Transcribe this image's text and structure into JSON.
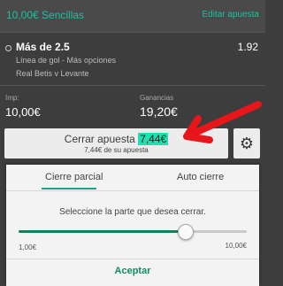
{
  "header": {
    "title": "10,00€ Sencillas",
    "edit_label": "Editar apuesta"
  },
  "selection": {
    "name": "Más de 2.5",
    "market": "Línea de gol - Más opciones",
    "event": "Real Betis v Levante",
    "odds": "1.92"
  },
  "stake": {
    "label": "Imp:",
    "value": "10,00€"
  },
  "returns": {
    "label": "Ganancias",
    "value": "19,20€"
  },
  "cashout": {
    "label": "Cerrar apuesta",
    "amount": "7,44€",
    "sub": "7,44€ de su apuesta"
  },
  "icons": {
    "settings": "gear-icon",
    "annotation": "red-arrow-icon",
    "radio": "radio-icon"
  },
  "colors": {
    "accent": "#14c59f",
    "highlight": "#1ee0b0",
    "arrow": "#e8151b",
    "slider": "#10815f"
  },
  "panel": {
    "tabs": [
      {
        "label": "Cierre parcial",
        "active": true
      },
      {
        "label": "Auto cierre",
        "active": false
      }
    ],
    "prompt": "Seleccione la parte que desea cerrar.",
    "slider": {
      "min_label": "1,00€",
      "max_label": "10,00€",
      "value_fraction": 0.73
    },
    "accept_label": "Aceptar"
  }
}
